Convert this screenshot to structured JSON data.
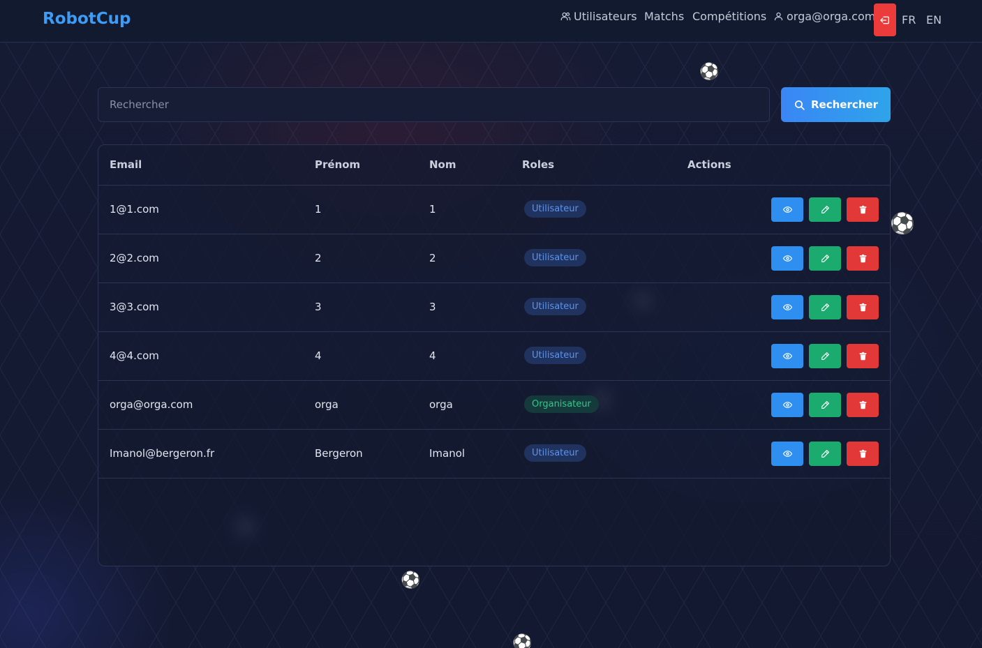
{
  "navbar": {
    "brand": "RobotCup",
    "links": {
      "users": "Utilisateurs",
      "matchs": "Matchs",
      "competitions": "Compétitions",
      "account": "orga@orga.com"
    },
    "langs": {
      "fr": "FR",
      "en": "EN"
    }
  },
  "search": {
    "placeholder": "Rechercher",
    "value": "",
    "button_label": "Rechercher"
  },
  "table": {
    "headers": {
      "email": "Email",
      "firstname": "Prénom",
      "lastname": "Nom",
      "roles": "Roles",
      "actions": "Actions"
    },
    "rows": [
      {
        "email": "1@1.com",
        "firstname": "1",
        "lastname": "1",
        "role": "Utilisateur"
      },
      {
        "email": "2@2.com",
        "firstname": "2",
        "lastname": "2",
        "role": "Utilisateur"
      },
      {
        "email": "3@3.com",
        "firstname": "3",
        "lastname": "3",
        "role": "Utilisateur"
      },
      {
        "email": "4@4.com",
        "firstname": "4",
        "lastname": "4",
        "role": "Utilisateur"
      },
      {
        "email": "orga@orga.com",
        "firstname": "orga",
        "lastname": "orga",
        "role": "Organisateur"
      },
      {
        "email": "Imanol@bergeron.fr",
        "firstname": "Bergeron",
        "lastname": "Imanol",
        "role": "Utilisateur"
      }
    ]
  },
  "decor": {
    "ball_glyph": "⚽"
  },
  "colors": {
    "accent": "#3d9cf5",
    "view": "#2e8ff0",
    "edit": "#1bab6e",
    "delete": "#e23838",
    "role_user": "#5b93f0",
    "role_org": "#2fc98a"
  }
}
